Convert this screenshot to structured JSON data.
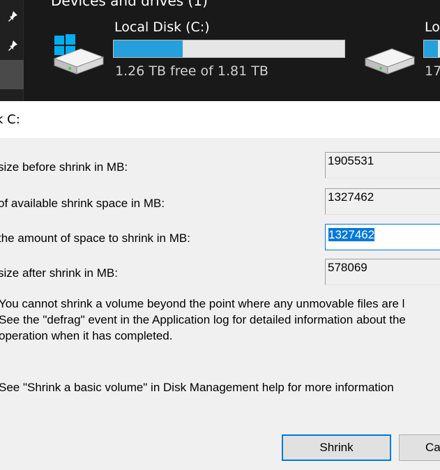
{
  "explorer": {
    "section_title": "Devices and drives (1)",
    "drives": [
      {
        "name": "Local Disk (C:)",
        "free_text": "1.26 TB free of 1.81 TB",
        "used_fraction": 0.3
      },
      {
        "name": "Lo",
        "free_text": "17",
        "used_fraction": 0.5
      }
    ]
  },
  "dialog": {
    "title": "k C:",
    "rows": [
      {
        "label": "size before shrink in MB:",
        "value": "1905531"
      },
      {
        "label": "of available shrink space in MB:",
        "value": "1327462"
      },
      {
        "label": "the amount of space to shrink in MB:",
        "value": "1327462"
      },
      {
        "label": "size after shrink in MB:",
        "value": "578069"
      }
    ],
    "note_lines": [
      "You cannot shrink a volume beyond the point where any unmovable files are l",
      "See the \"defrag\" event in the Application log for detailed information about the",
      "operation when it has completed."
    ],
    "help_text": "See \"Shrink a basic volume\" in Disk Management help for more information",
    "buttons": {
      "shrink": "Shrink",
      "cancel": "Ca"
    }
  },
  "colors": {
    "accent": "#0078d7",
    "drive_bar_fill": "#26a0da",
    "explorer_bg": "#191919",
    "windows_logo": "#00adef"
  }
}
